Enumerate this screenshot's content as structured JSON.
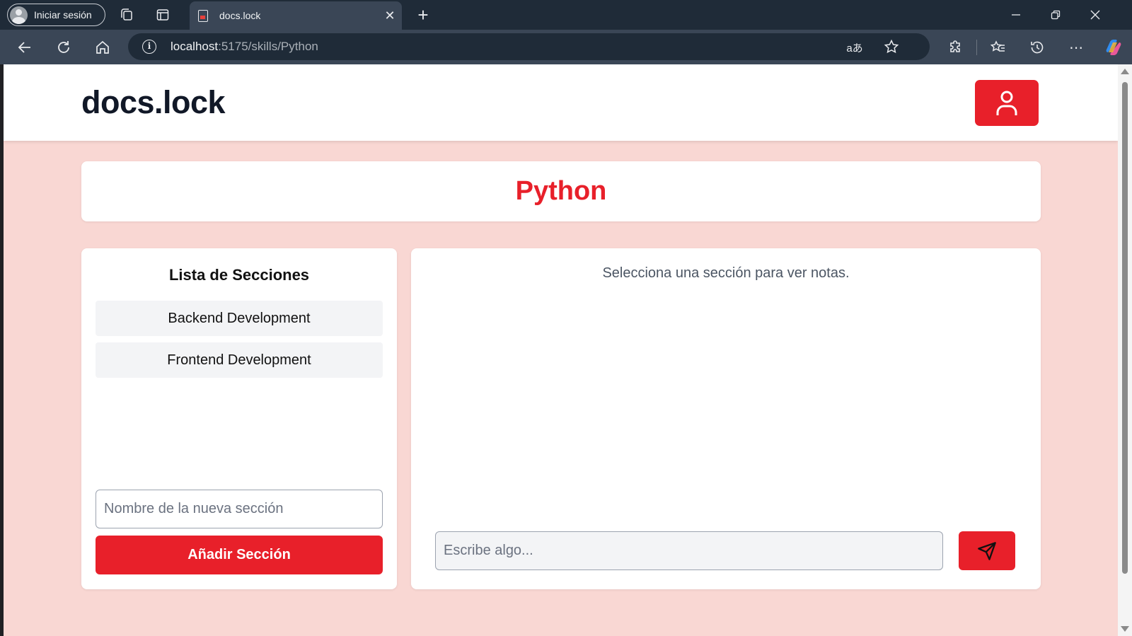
{
  "browser": {
    "profile_label": "Iniciar sesión",
    "tab_title": "docs.lock",
    "url_host": "localhost",
    "url_path": ":5175/skills/Python"
  },
  "header": {
    "logo": "docs.lock"
  },
  "skill": {
    "title": "Python"
  },
  "sections_panel": {
    "heading": "Lista de Secciones",
    "items": [
      {
        "label": "Backend Development"
      },
      {
        "label": "Frontend Development"
      }
    ],
    "new_section_placeholder": "Nombre de la nueva sección",
    "add_button_label": "Añadir Sección"
  },
  "notes_panel": {
    "empty_message": "Selecciona una sección para ver notas.",
    "input_placeholder": "Escribe algo..."
  },
  "colors": {
    "accent": "#e8202a",
    "page_background": "#f9d7d3"
  }
}
